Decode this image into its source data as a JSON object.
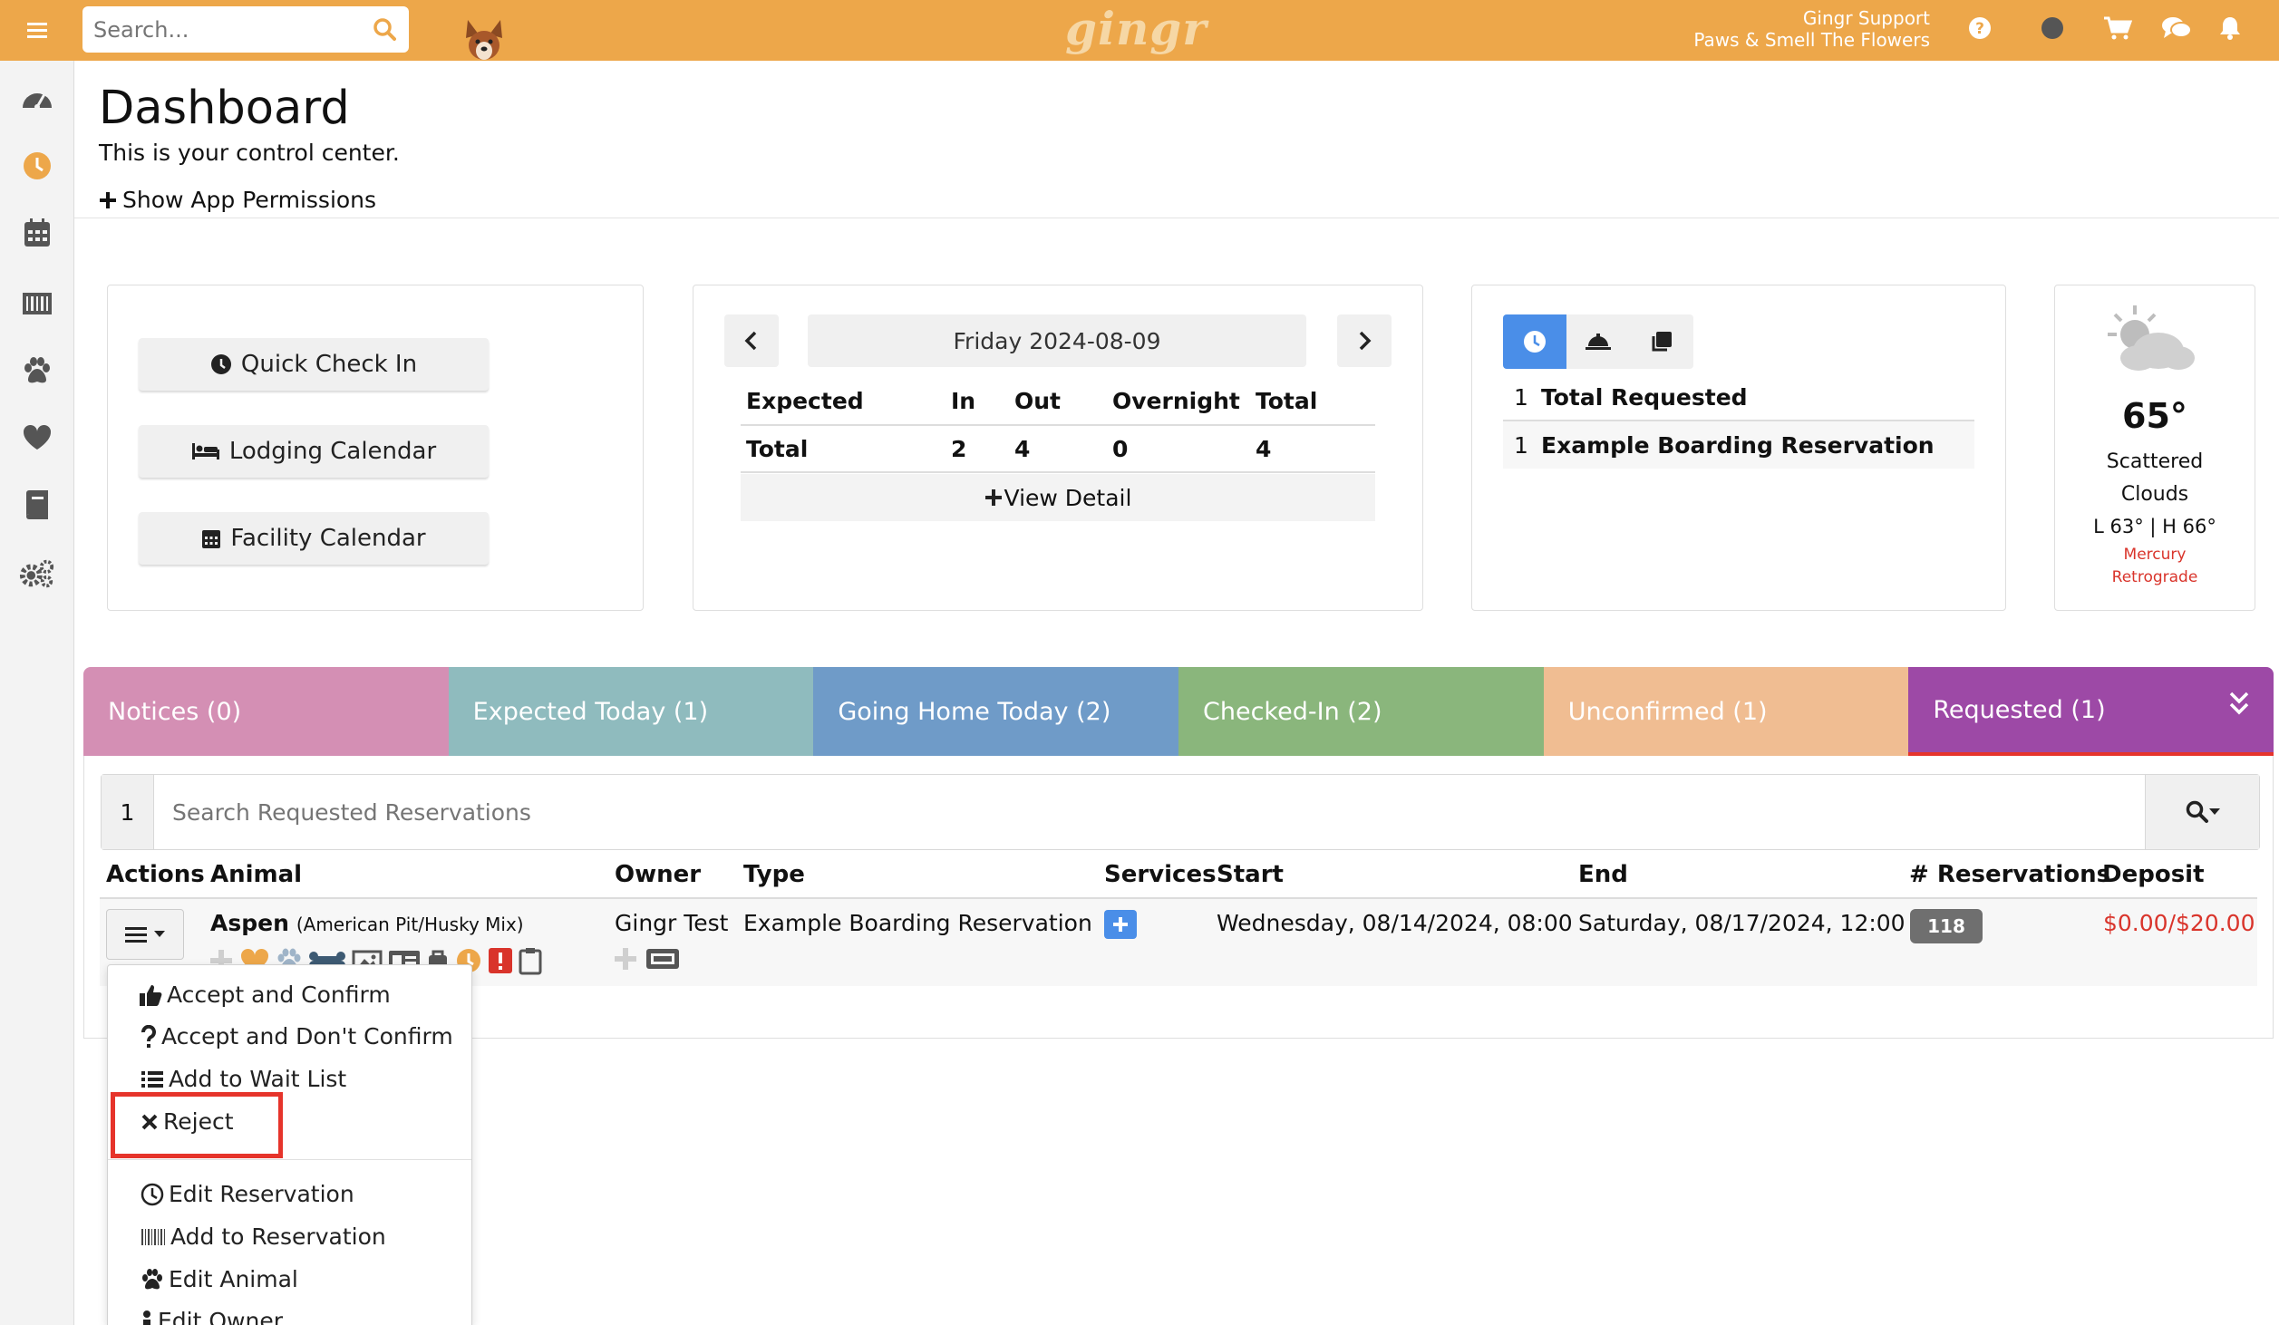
{
  "topbar": {
    "search_placeholder": "Search...",
    "brand": "gingr",
    "user_name": "Gingr Support",
    "business_name": "Paws & Smell The Flowers",
    "icons": [
      "help-icon",
      "status-icon",
      "cart-icon",
      "chat-icon",
      "bell-icon"
    ],
    "color": "#eda74a"
  },
  "sidebar": {
    "icons": [
      "dashboard-icon",
      "clock-icon",
      "calendar-icon",
      "barcode-icon",
      "paw-icon",
      "heart-icon",
      "book-icon",
      "settings-icon"
    ],
    "active": "clock-icon"
  },
  "header": {
    "title": "Dashboard",
    "subtitle": "This is your control center.",
    "permissions_link": "Show App Permissions"
  },
  "quick_links": {
    "check_in": "Quick Check In",
    "lodging": "Lodging Calendar",
    "facility": "Facility Calendar"
  },
  "day_summary": {
    "date": "Friday 2024-08-09",
    "headers": [
      "Expected",
      "In",
      "Out",
      "Overnight",
      "Total"
    ],
    "row": [
      "Total",
      "2",
      "4",
      "0",
      "4"
    ],
    "view_detail": "View Detail"
  },
  "requested_summary": {
    "rows": [
      {
        "count": "1",
        "label": "Total Requested"
      },
      {
        "count": "1",
        "label": "Example Boarding Reservation"
      }
    ],
    "accent": "#4a8ee8"
  },
  "weather": {
    "temp": "65°",
    "condition_line1": "Scattered",
    "condition_line2": "Clouds",
    "range": "L 63° | H 66°",
    "note_line1": "Mercury",
    "note_line2": "Retrograde",
    "note_color": "#d9342b"
  },
  "tabs": [
    {
      "label": "Notices (0)",
      "color": "#d48fb4"
    },
    {
      "label": "Expected Today (1)",
      "color": "#8fbbbe"
    },
    {
      "label": "Going Home Today (2)",
      "color": "#6f9bc8"
    },
    {
      "label": "Checked-In (2)",
      "color": "#8ab67c"
    },
    {
      "label": "Unconfirmed (1)",
      "color": "#f0bd92"
    },
    {
      "label": "Requested (1)",
      "color": "#9d49a6"
    }
  ],
  "reservations": {
    "count": "1",
    "search_placeholder": "Search Requested Reservations",
    "columns": [
      "Actions",
      "Animal",
      "Owner",
      "Type",
      "Services",
      "Start",
      "End",
      "# Reservations",
      "Deposit"
    ],
    "row": {
      "animal_name": "Aspen",
      "animal_breed": "(American Pit/Husky Mix)",
      "owner": "Gingr Test",
      "type": "Example Boarding Reservation",
      "start": "Wednesday, 08/14/2024, 08:00",
      "end": "Saturday, 08/17/2024, 12:00",
      "reservation_count": "118",
      "deposit": "$0.00/$20.00"
    }
  },
  "actions_menu": {
    "items": [
      {
        "label": "Accept and Confirm",
        "icon": "thumbs-up-icon"
      },
      {
        "label": "Accept and Don't Confirm",
        "icon": "question-icon"
      },
      {
        "label": "Add to Wait List",
        "icon": "list-icon"
      },
      {
        "label": "Reject",
        "icon": "x-icon"
      },
      {
        "label": "Edit Reservation",
        "icon": "clock-icon"
      },
      {
        "label": "Add to Reservation",
        "icon": "barcode-icon"
      },
      {
        "label": "Edit Animal",
        "icon": "paw-icon"
      },
      {
        "label": "Edit Owner",
        "icon": "user-icon"
      }
    ]
  }
}
